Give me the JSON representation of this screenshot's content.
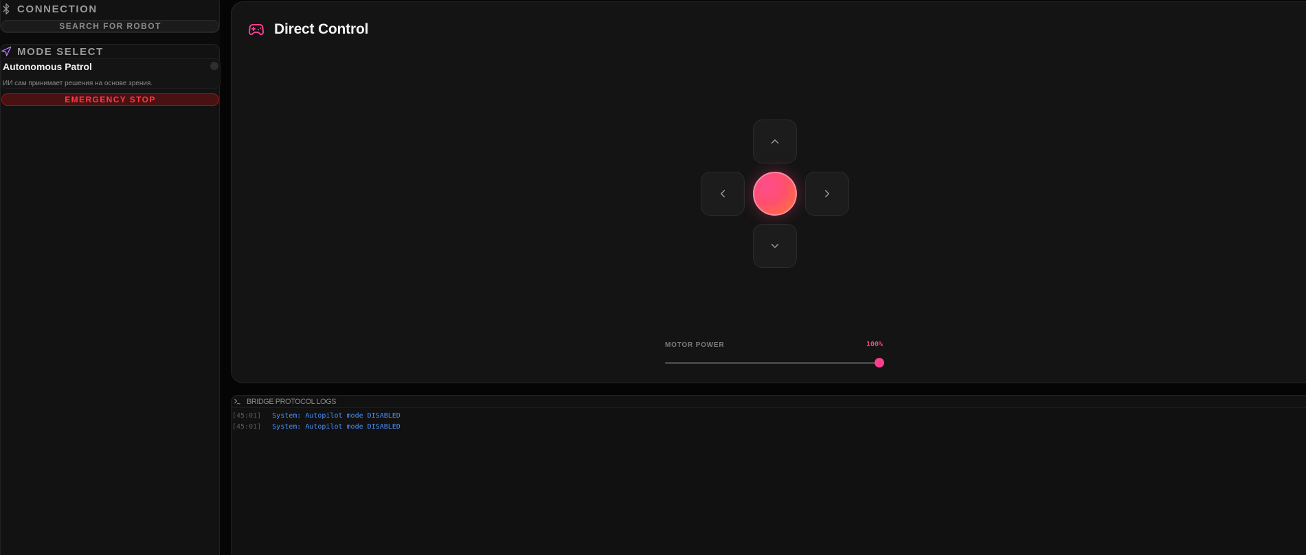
{
  "sidebar": {
    "connection": {
      "title": "CONNECTION",
      "icon": "bluetooth-icon",
      "search_button_label": "SEARCH FOR ROBOT"
    },
    "mode_select": {
      "title": "MODE SELECT",
      "icon": "navigation-icon",
      "mode_name": "Autonomous Patrol",
      "mode_description": "ИИ сам принимает решения на основе зрения.",
      "emergency_button_label": "EMERGENCY STOP"
    }
  },
  "control_panel": {
    "title": "Direct Control",
    "icon": "gamepad-icon",
    "dpad": {
      "up_icon": "chevron-up-icon",
      "down_icon": "chevron-down-icon",
      "left_icon": "chevron-left-icon",
      "right_icon": "chevron-right-icon"
    },
    "motor_power": {
      "label": "MOTOR POWER",
      "value_text": "100%",
      "value_fraction": 1.0
    }
  },
  "logs": {
    "title": "BRIDGE PROTOCOL LOGS",
    "icon": "terminal-icon",
    "entries": [
      {
        "time": "[45:01]",
        "message": "System: Autopilot mode DISABLED"
      },
      {
        "time": "[45:01]",
        "message": "System: Autopilot mode DISABLED"
      }
    ]
  },
  "colors": {
    "accent": "#ff3d8e",
    "accent_orange": "#ff7a2e",
    "emergency": "#ff3b45",
    "log_message": "#4a90ff",
    "mode_icon": "#b57bff"
  }
}
